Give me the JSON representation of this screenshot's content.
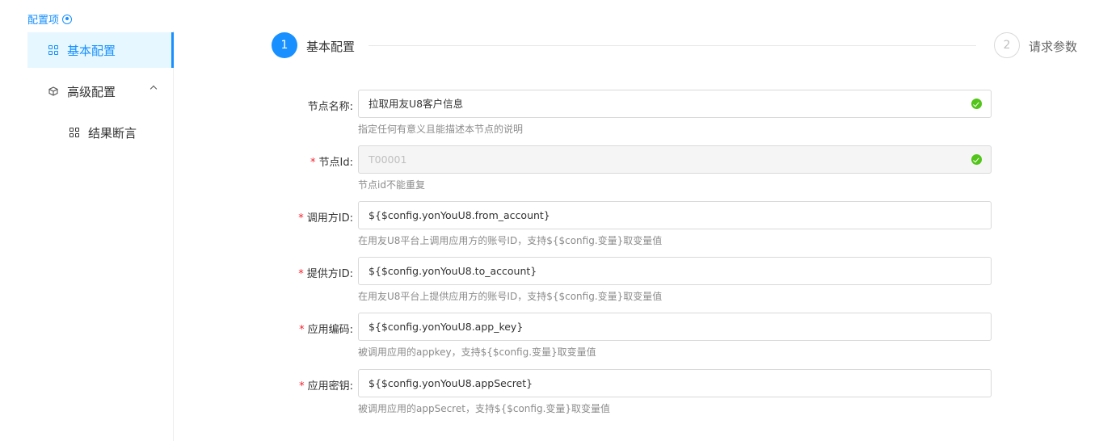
{
  "sidebar": {
    "title": "配置项",
    "items": [
      {
        "label": "基本配置"
      },
      {
        "label": "高级配置"
      },
      {
        "label": "结果断言"
      }
    ]
  },
  "steps": [
    {
      "number": "1",
      "label": "基本配置"
    },
    {
      "number": "2",
      "label": "请求参数"
    }
  ],
  "form": {
    "fields": [
      {
        "label": "节点名称:",
        "value": "拉取用友U8客户信息",
        "help": "指定任何有意义且能描述本节点的说明"
      },
      {
        "label": "节点Id:",
        "value": "T00001",
        "help": "节点id不能重复"
      },
      {
        "label": "调用方ID:",
        "value": "${$config.yonYouU8.from_account}",
        "help": "在用友U8平台上调用应用方的账号ID，支持${$config.变量}取变量值"
      },
      {
        "label": "提供方ID:",
        "value": "${$config.yonYouU8.to_account}",
        "help": "在用友U8平台上提供应用方的账号ID，支持${$config.变量}取变量值"
      },
      {
        "label": "应用编码:",
        "value": "${$config.yonYouU8.app_key}",
        "help": "被调用应用的appkey，支持${$config.变量}取变量值"
      },
      {
        "label": "应用密钥:",
        "value": "${$config.yonYouU8.appSecret}",
        "help": "被调用应用的appSecret，支持${$config.变量}取变量值"
      }
    ]
  },
  "colors": {
    "accent": "#1890ff",
    "success": "#52c41a",
    "required": "#f5222d"
  }
}
